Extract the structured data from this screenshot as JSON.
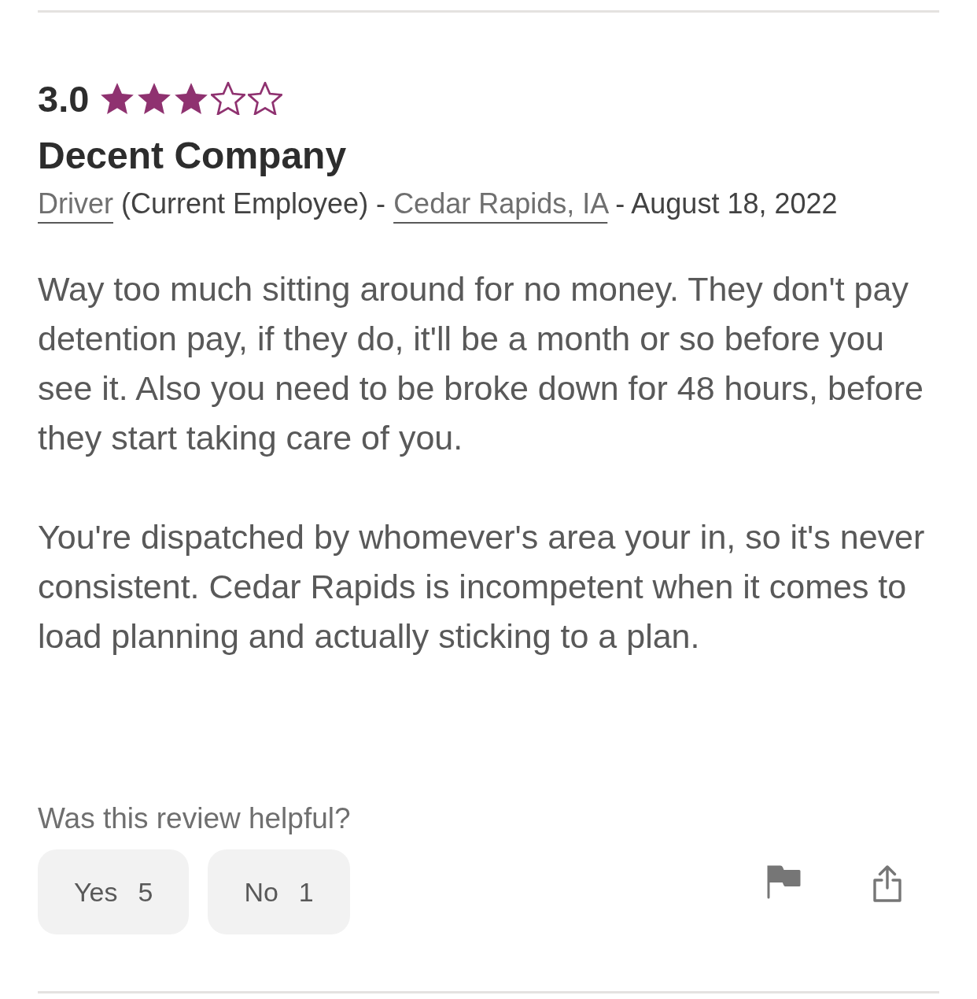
{
  "review": {
    "rating": "3.0",
    "stars": 3,
    "title": "Decent Company",
    "meta": [
      {
        "kind": "link",
        "text": "Driver"
      },
      {
        "kind": "text",
        "text": "(Current Employee) -"
      },
      {
        "kind": "link",
        "text": "Cedar Rapids, IA"
      },
      {
        "kind": "text",
        "text": "- August 18, 2022"
      }
    ],
    "paragraphs": [
      "Way too much sitting around for no money. They don't pay detention pay, if they do, it'll be a month or so before you see it. Also you need to be broke down for 48 hours, before they start taking care of you.",
      "You're dispatched by whomever's area your in, so it's never consistent. Cedar Rapids is incompetent when it comes to load planning and actually sticking to a plan."
    ]
  },
  "helpful": {
    "question": "Was this review helpful?",
    "buttons": [
      {
        "label": "Yes",
        "count": "5"
      },
      {
        "label": "No",
        "count": "1"
      }
    ]
  }
}
